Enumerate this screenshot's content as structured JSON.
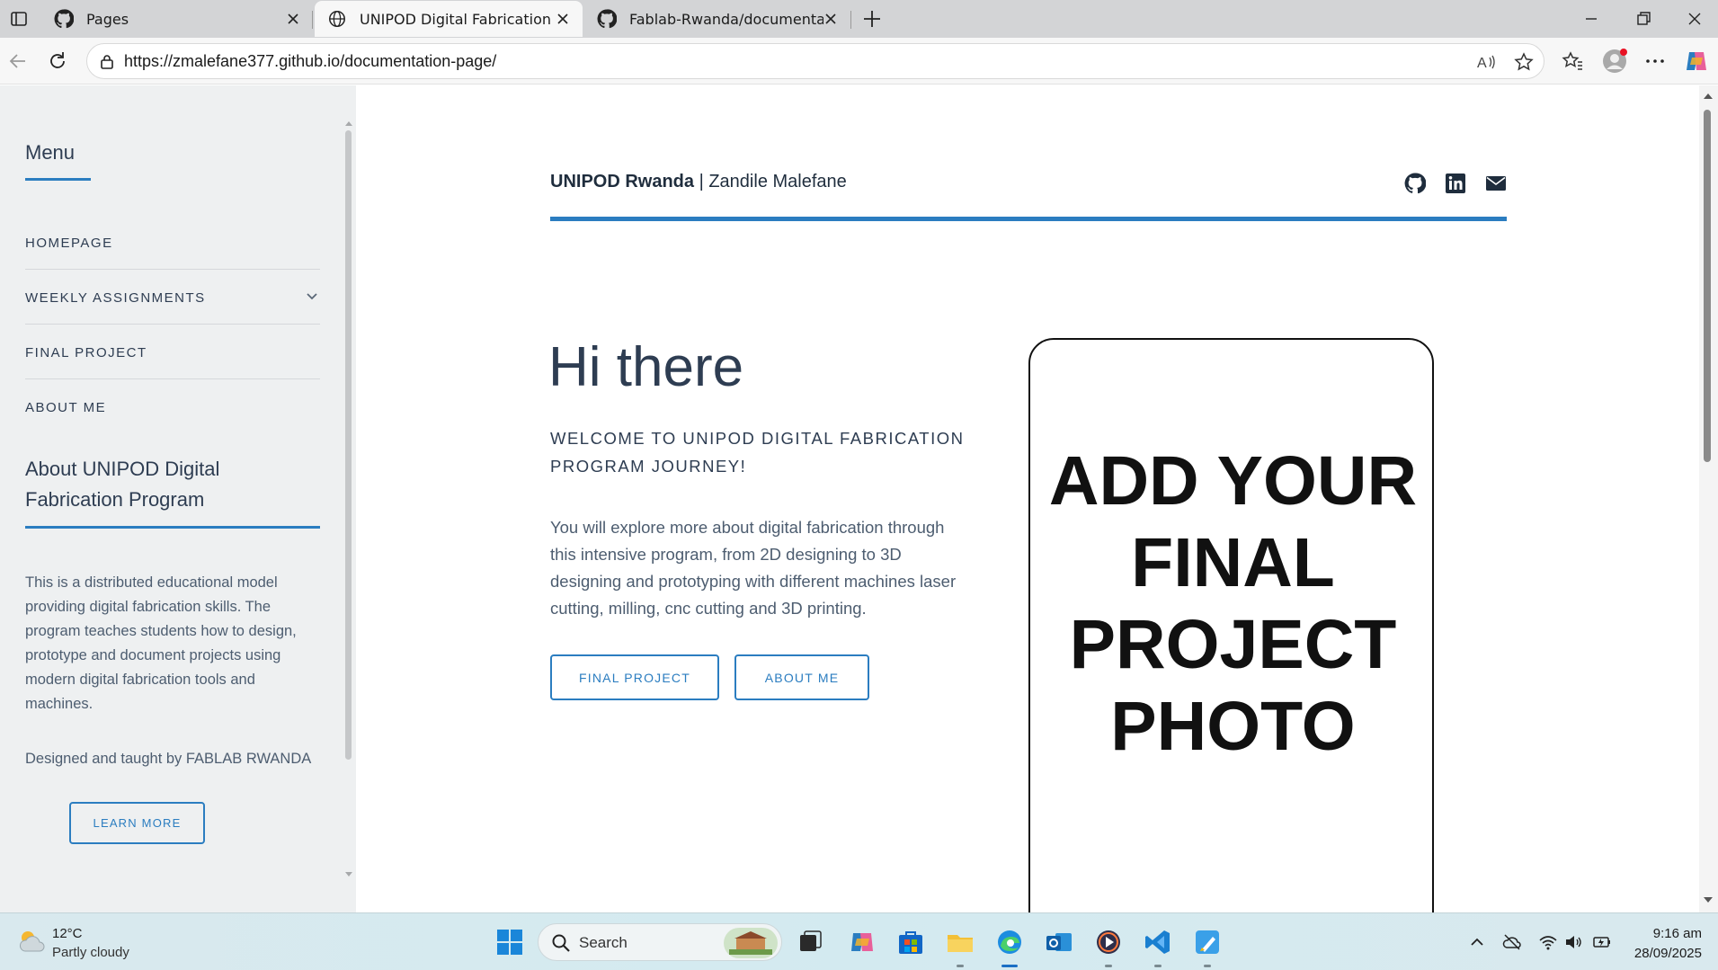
{
  "browser": {
    "tabs": [
      {
        "title": "Pages",
        "icon": "github-icon",
        "active": false
      },
      {
        "title": "UNIPOD Digital Fabrication Progr",
        "icon": "globe-icon",
        "active": true
      },
      {
        "title": "Fablab-Rwanda/documentation-p",
        "icon": "github-icon",
        "active": false
      }
    ],
    "url": "https://zmalefane377.github.io/documentation-page/"
  },
  "sidebar": {
    "menu_title": "Menu",
    "items": [
      {
        "label": "HOMEPAGE"
      },
      {
        "label": "WEEKLY ASSIGNMENTS",
        "has_submenu": true
      },
      {
        "label": "FINAL PROJECT"
      },
      {
        "label": "ABOUT ME"
      }
    ],
    "about_title": "About UNIPOD Digital Fabrication Program",
    "about_body": "This is a distributed educational model providing digital fabrication skills. The program teaches students how to design, prototype and document projects using modern digital fabrication tools and machines.",
    "about_credit": "Designed and taught by FABLAB RWANDA",
    "learn_more_label": "LEARN MORE"
  },
  "header": {
    "site_title_bold": "UNIPOD Rwanda",
    "site_title_rest": " | Zandile Malefane",
    "social_icons": [
      "github-icon",
      "linkedin-icon",
      "envelope-icon"
    ]
  },
  "hero": {
    "heading": "Hi there",
    "subtitle": "WELCOME TO UNIPOD DIGITAL FABRICATION PROGRAM JOURNEY!",
    "body": "You will explore more about digital fabrication through this intensive program, from 2D designing to 3D designing and prototyping with different machines laser cutting, milling, cnc cutting and 3D printing.",
    "buttons": [
      {
        "label": "FINAL PROJECT"
      },
      {
        "label": "ABOUT ME"
      }
    ],
    "photo_placeholder": "ADD YOUR FINAL PROJECT PHOTO"
  },
  "taskbar": {
    "weather_temp": "12°C",
    "weather_desc": "Partly cloudy",
    "search_label": "Search",
    "clock_time": "9:16 am",
    "clock_date": "28/09/2025"
  },
  "colors": {
    "accent": "#2b7dc0",
    "text_dark": "#2e3d52",
    "sidebar_bg": "#eef0f1"
  }
}
